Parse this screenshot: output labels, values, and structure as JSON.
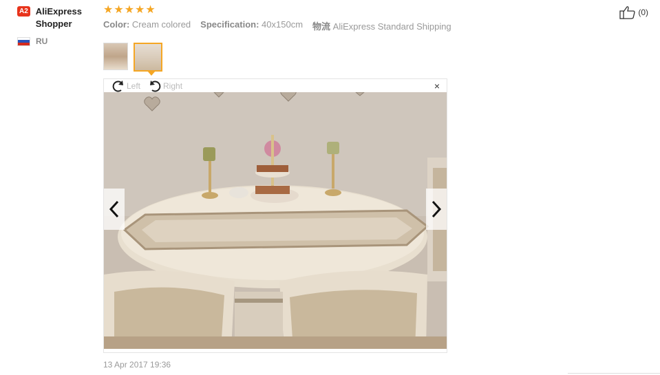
{
  "user": {
    "badge": "A2",
    "name": "AliExpress Shopper",
    "country": "RU"
  },
  "review": {
    "stars": 5,
    "spec": {
      "color_label": "Color:",
      "color_value": "Cream colored",
      "specification_label": "Specification:",
      "specification_value": "40x150cm",
      "shipping_label": "物流",
      "shipping_value": "AliExpress Standard Shipping"
    },
    "date": "13 Apr 2017 19:36",
    "likes": "(0)"
  },
  "viewer": {
    "rotate_left": "Left",
    "rotate_right": "Right",
    "close": "×",
    "thumbnail_count": 2,
    "active_thumbnail": 2
  },
  "colors": {
    "accent": "#f5a623",
    "badge": "#e8341c"
  }
}
